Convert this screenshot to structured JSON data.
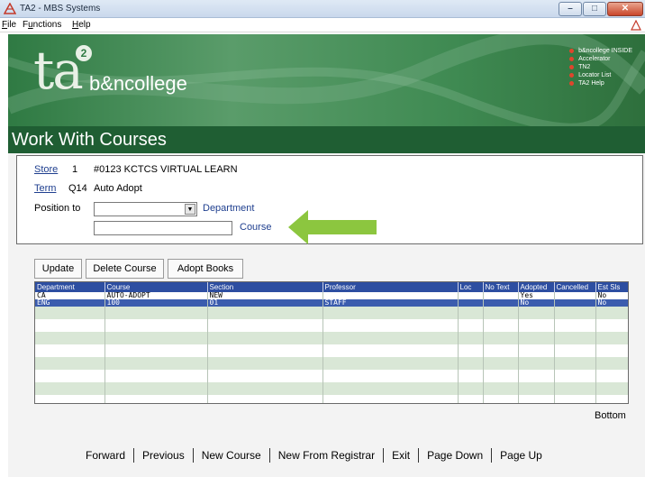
{
  "window": {
    "title": "TA2 - MBS Systems",
    "controls": {
      "minimize": "–",
      "maximize": "□",
      "close": "✕"
    }
  },
  "menu": {
    "items": [
      {
        "accel": "F",
        "rest": "ile"
      },
      {
        "pre": "F",
        "accel": "u",
        "rest": "nctions"
      },
      {
        "accel": "H",
        "rest": "elp"
      }
    ]
  },
  "banner": {
    "logo_main": "ta",
    "logo_super": "2",
    "logo_college": "b&ncollege",
    "links": [
      "b&ncollege INSIDE",
      "Accelerator",
      "TN2",
      "Locator List",
      "TA2 Help"
    ]
  },
  "page": {
    "title": "Work With Courses"
  },
  "criteria": {
    "store_label": "Store",
    "store_value": "1",
    "store_name": "#0123 KCTCS VIRTUAL LEARN",
    "term_label": "Term",
    "term_value": "Q14",
    "term_name": "Auto Adopt",
    "position_label": "Position to",
    "department_label": "Department",
    "department_value": "",
    "course_label": "Course",
    "course_value": ""
  },
  "actions": {
    "update": "Update",
    "delete_course": "Delete Course",
    "adopt_books": "Adopt Books"
  },
  "grid": {
    "columns": [
      "Department",
      "Course",
      "Section",
      "Professor",
      "Loc",
      "No Text",
      "Adopted",
      "Cancelled",
      "Est Sls"
    ],
    "rows": [
      [
        "CA",
        "AUTO-ADOPT",
        "NEW",
        "",
        "",
        "",
        "Yes",
        "",
        "No"
      ],
      [
        "ENG",
        "100",
        "01",
        "STAFF",
        "",
        "",
        "No",
        "",
        "No"
      ]
    ],
    "selected_row": 1,
    "bottom_label": "Bottom"
  },
  "footer": {
    "items": [
      "Forward",
      "Previous",
      "New Course",
      "New From Registrar",
      "Exit",
      "Page Down",
      "Page Up"
    ]
  },
  "colors": {
    "banner_green": "#2f7a43",
    "title_green": "#1f5e33",
    "grid_header": "#2d4ea1",
    "selected_row": "#3b5cae",
    "arrow_green": "#8cc63f",
    "link_blue": "#1f3f8f"
  },
  "icons": {
    "app": "mbs-app-icon",
    "dropdown": "chevron-down-icon",
    "banner_bullet": "red-dot-icon",
    "pointer": "left-arrow-icon"
  }
}
